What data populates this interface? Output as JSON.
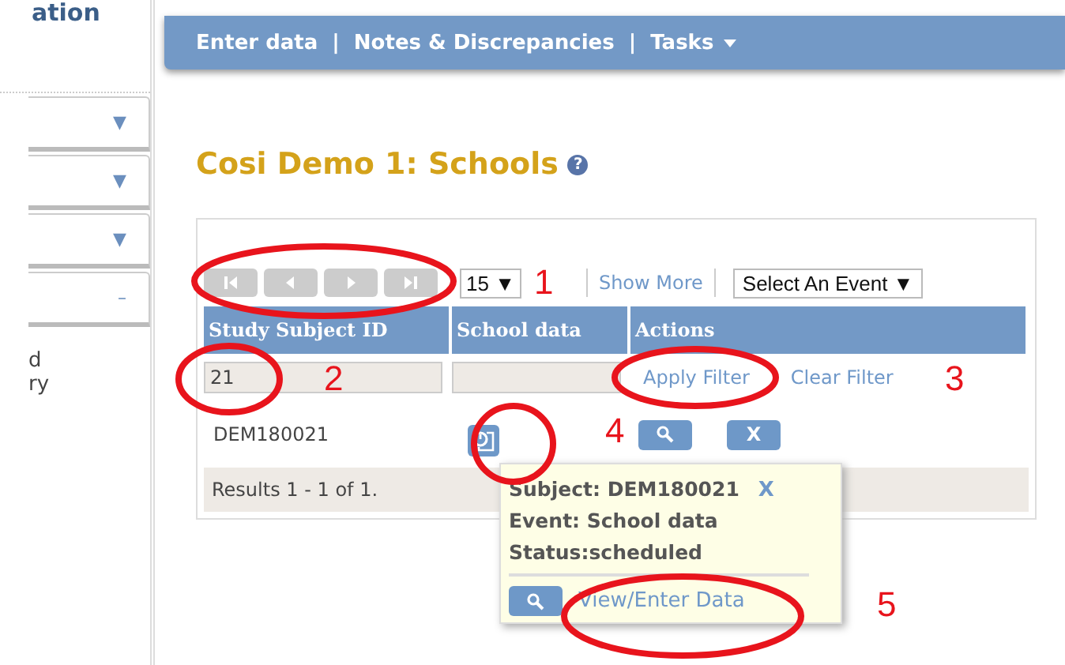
{
  "brand_fragment": "ation",
  "sidebar": {
    "tabs": [
      {
        "icon": "▼"
      },
      {
        "icon": "▼"
      },
      {
        "icon": "▼"
      },
      {
        "icon": "–"
      }
    ],
    "fragments": [
      "d",
      "ry"
    ]
  },
  "nav": {
    "items": [
      "Enter data",
      "Notes & Discrepancies",
      "Tasks"
    ],
    "separators": [
      "|",
      "|"
    ]
  },
  "title": "Cosi Demo 1: Schools",
  "help": "?",
  "toolbar": {
    "page_size": "15",
    "page_size_caret": "▼",
    "show_more": "Show More",
    "event_select": "Select An Event",
    "event_caret": "▼"
  },
  "table": {
    "columns": [
      "Study Subject ID",
      "School data",
      "Actions"
    ],
    "filter": {
      "subject_id": "21",
      "apply": "Apply Filter",
      "clear": "Clear Filter"
    },
    "rows": [
      {
        "subject_id": "DEM180021",
        "remove": "X"
      }
    ],
    "footer": "Results 1 - 1 of 1."
  },
  "popup": {
    "lines": [
      "Subject: DEM180021",
      "Event: School data",
      "Status:scheduled"
    ],
    "close": "X",
    "link": "View/Enter Data"
  },
  "annotations": [
    "1",
    "2",
    "3",
    "4",
    "5"
  ]
}
